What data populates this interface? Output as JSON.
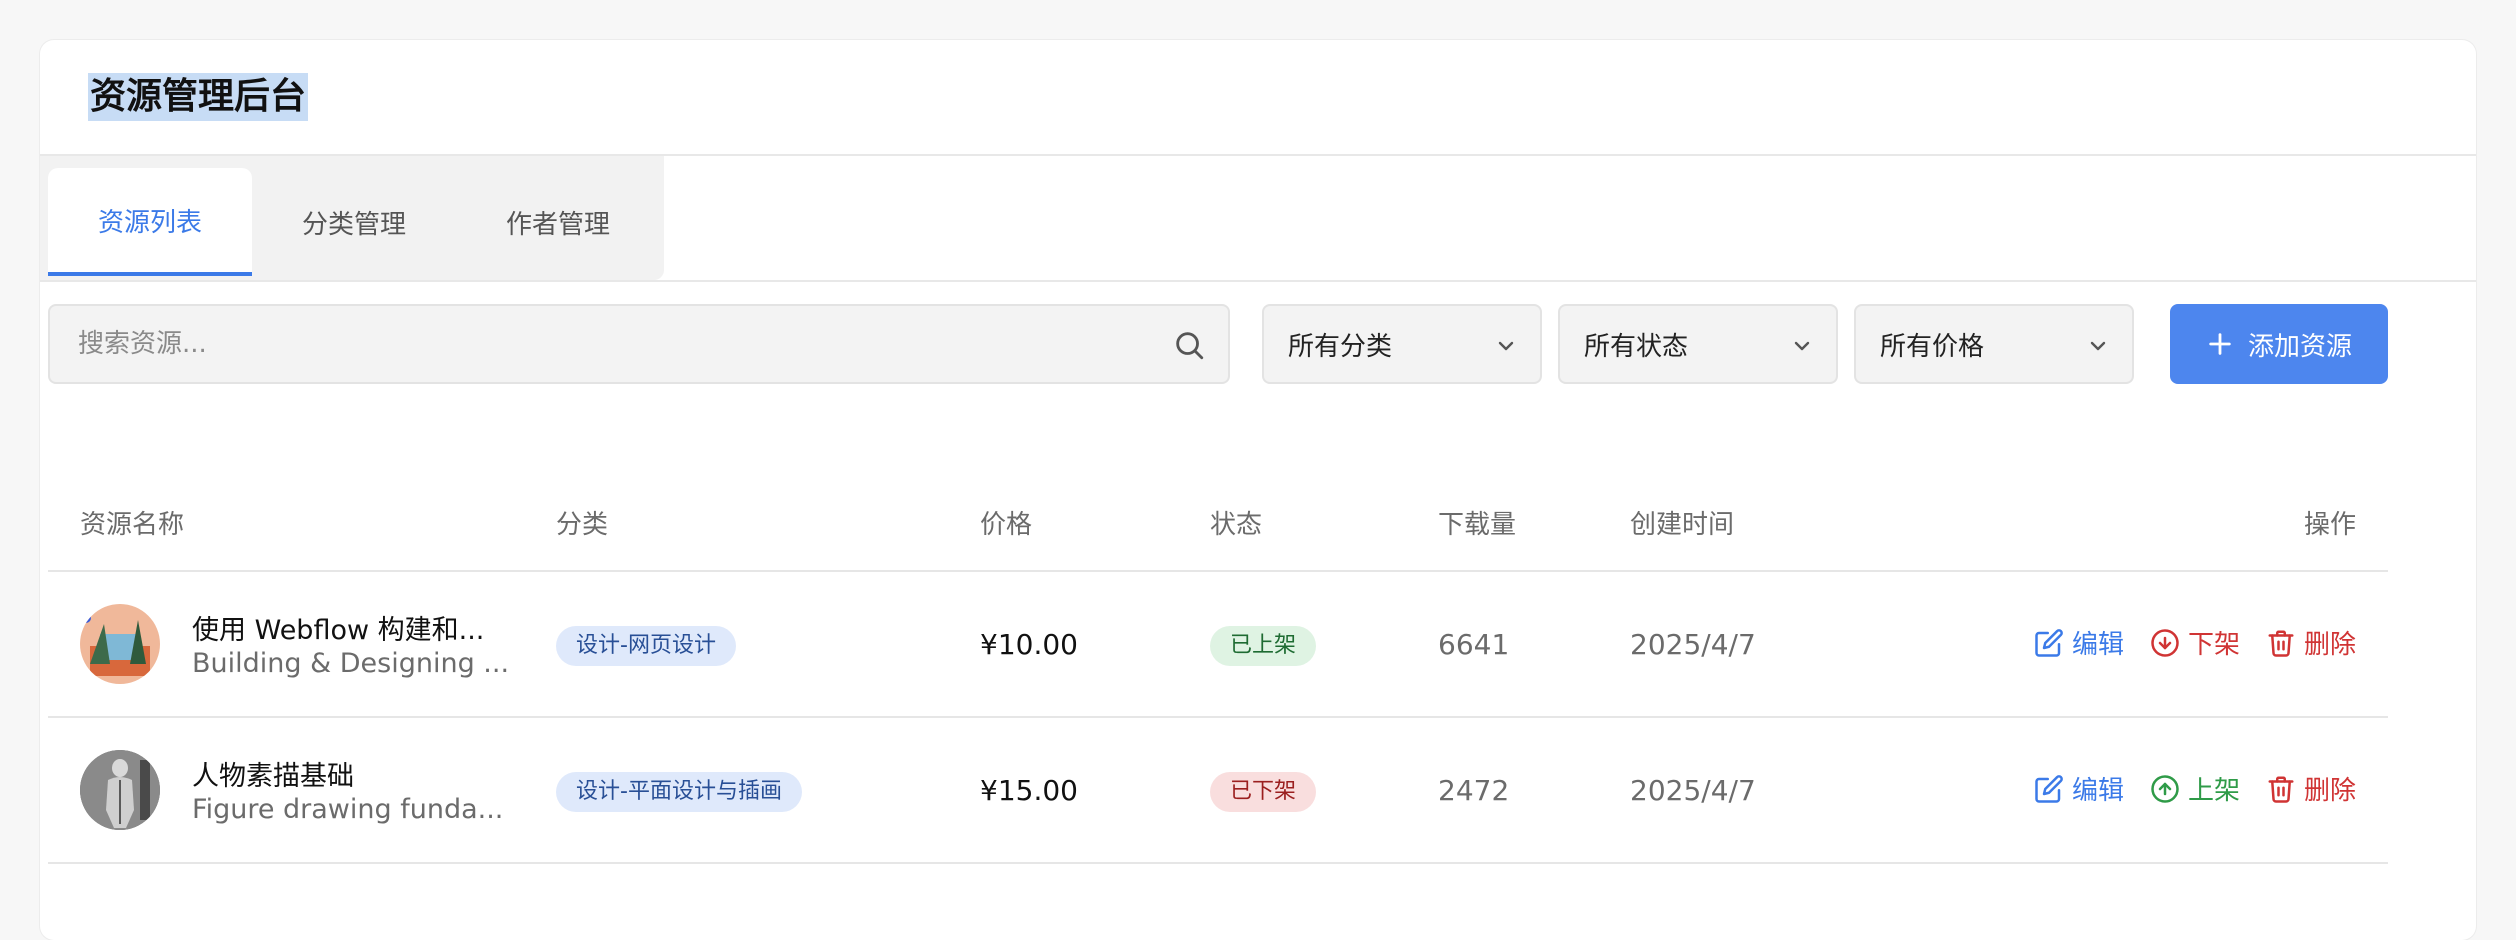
{
  "header": {
    "title": "资源管理后台"
  },
  "tabs": [
    {
      "label": "资源列表",
      "active": true
    },
    {
      "label": "分类管理",
      "active": false
    },
    {
      "label": "作者管理",
      "active": false
    }
  ],
  "toolbar": {
    "search_placeholder": "搜索资源...",
    "filters": {
      "category": "所有分类",
      "status": "所有状态",
      "price": "所有价格"
    },
    "add_label": "添加资源"
  },
  "table": {
    "columns": [
      "资源名称",
      "分类",
      "价格",
      "状态",
      "下载量",
      "创建时间",
      "操作"
    ],
    "rows": [
      {
        "name": "使用 Webflow 构建和...",
        "subtitle": "Building & Designing ...",
        "category": "设计-网页设计",
        "price": "¥10.00",
        "status": "已上架",
        "downloads": "6641",
        "created": "2025/4/7",
        "actions": {
          "edit": "编辑",
          "toggle": "下架",
          "delete": "删除"
        }
      },
      {
        "name": "人物素描基础",
        "subtitle": "Figure drawing funda...",
        "category": "设计-平面设计与插画",
        "price": "¥15.00",
        "status": "已下架",
        "downloads": "2472",
        "created": "2025/4/7",
        "actions": {
          "edit": "编辑",
          "toggle": "上架",
          "delete": "删除"
        }
      }
    ]
  },
  "colors": {
    "accent": "#4d86ee",
    "edit": "#3b7ae8",
    "danger": "#d03434",
    "success": "#2f9b48",
    "status_on_bg": "#dff3e3",
    "status_off_bg": "#f9dede"
  },
  "icons": [
    "search-icon",
    "chevron-down-icon",
    "plus-icon",
    "edit-icon",
    "arrow-down-circle-icon",
    "arrow-up-circle-icon",
    "trash-icon"
  ]
}
